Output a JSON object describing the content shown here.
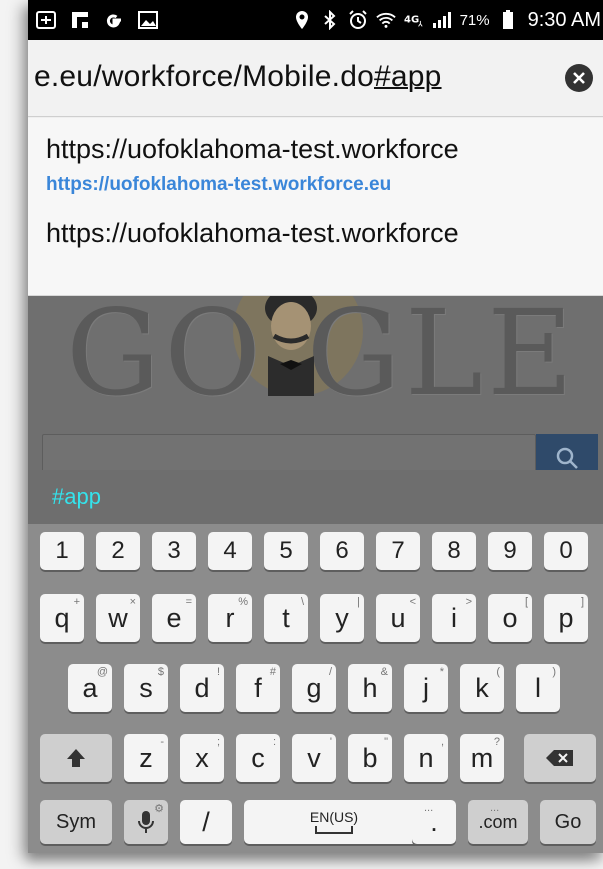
{
  "status_bar": {
    "battery_percent": "71%",
    "time": "9:30 AM",
    "icons": [
      "ab-icon",
      "flipboard-icon",
      "google-icon",
      "gallery-icon",
      "location-icon",
      "bluetooth-icon",
      "alarm-icon",
      "wifi-icon",
      "lte-icon",
      "signal-icon",
      "battery-icon"
    ]
  },
  "address_bar": {
    "url_prefix": "е.eu/workforce/Mobile.do",
    "url_hash": "#app"
  },
  "suggestions": [
    {
      "title": "https://uofoklahoma-test.workforce",
      "url": "https://uofoklahoma-test.workforce.eu"
    },
    {
      "title": "https://uofoklahoma-test.workforce"
    }
  ],
  "background_page": {
    "doodle_text": "GO  GLE"
  },
  "keyboard": {
    "prediction": "#app",
    "number_row": [
      "1",
      "2",
      "3",
      "4",
      "5",
      "6",
      "7",
      "8",
      "9",
      "0"
    ],
    "row1": [
      {
        "key": "q",
        "hint": "+"
      },
      {
        "key": "w",
        "hint": "×"
      },
      {
        "key": "e",
        "hint": "="
      },
      {
        "key": "r",
        "hint": "%"
      },
      {
        "key": "t",
        "hint": "\\"
      },
      {
        "key": "y",
        "hint": "|"
      },
      {
        "key": "u",
        "hint": "<"
      },
      {
        "key": "i",
        "hint": ">"
      },
      {
        "key": "o",
        "hint": "["
      },
      {
        "key": "p",
        "hint": "]"
      }
    ],
    "row2": [
      {
        "key": "a",
        "hint": "@"
      },
      {
        "key": "s",
        "hint": "$"
      },
      {
        "key": "d",
        "hint": "!"
      },
      {
        "key": "f",
        "hint": "#"
      },
      {
        "key": "g",
        "hint": "/"
      },
      {
        "key": "h",
        "hint": "&"
      },
      {
        "key": "j",
        "hint": "*"
      },
      {
        "key": "k",
        "hint": "("
      },
      {
        "key": "l",
        "hint": ")"
      }
    ],
    "row3": [
      {
        "key": "z",
        "hint": "-"
      },
      {
        "key": "x",
        "hint": ";"
      },
      {
        "key": "c",
        "hint": ":"
      },
      {
        "key": "v",
        "hint": "'"
      },
      {
        "key": "b",
        "hint": "\""
      },
      {
        "key": "n",
        "hint": ","
      },
      {
        "key": "m",
        "hint": "?"
      }
    ],
    "bottom": {
      "sym": "Sym",
      "slash": "/",
      "space": "EN(US)",
      "period": ".",
      "dotcom": ".com",
      "go": "Go"
    }
  }
}
